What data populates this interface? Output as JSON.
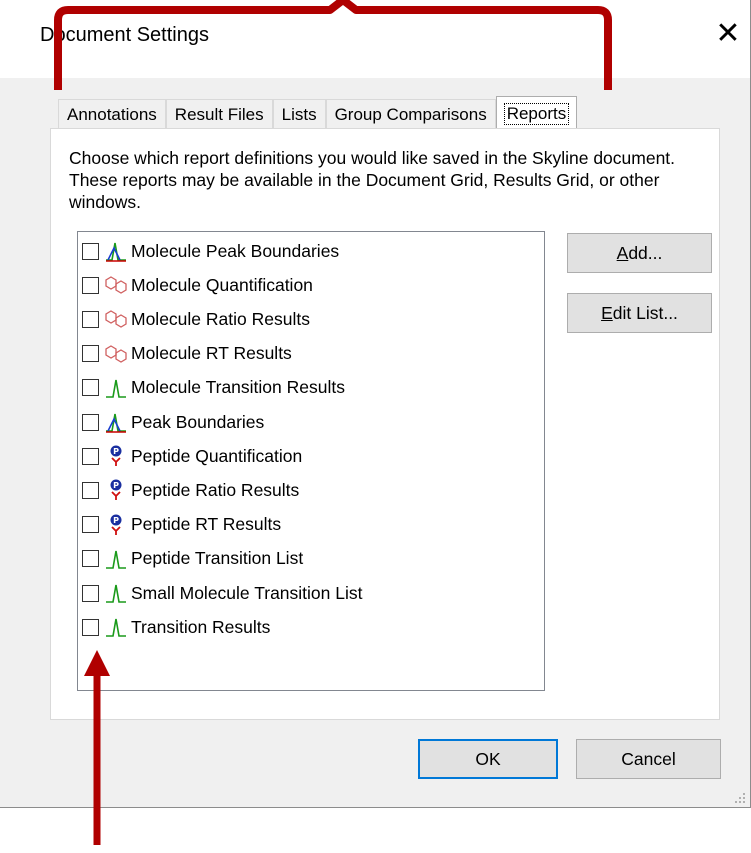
{
  "window": {
    "title": "Document Settings",
    "close_glyph": "✕"
  },
  "tabs": [
    {
      "label": "Annotations",
      "active": false
    },
    {
      "label": "Result Files",
      "active": false
    },
    {
      "label": "Lists",
      "active": false
    },
    {
      "label": "Group Comparisons",
      "active": false
    },
    {
      "label": "Reports",
      "active": true
    }
  ],
  "reports": {
    "description": "Choose which report definitions you would like saved in the Skyline document. These reports may be available in the Document Grid, Results Grid, or other windows.",
    "items": [
      {
        "label": "Molecule Peak Boundaries",
        "icon": "peak-boundaries-icon",
        "checked": false
      },
      {
        "label": "Molecule Quantification",
        "icon": "molecule-icon",
        "checked": false
      },
      {
        "label": "Molecule Ratio Results",
        "icon": "molecule-icon",
        "checked": false
      },
      {
        "label": "Molecule RT Results",
        "icon": "molecule-icon",
        "checked": false
      },
      {
        "label": "Molecule Transition Results",
        "icon": "transition-peak-icon",
        "checked": false
      },
      {
        "label": "Peak Boundaries",
        "icon": "peak-boundaries-icon",
        "checked": false
      },
      {
        "label": "Peptide Quantification",
        "icon": "peptide-icon",
        "checked": false
      },
      {
        "label": "Peptide Ratio Results",
        "icon": "peptide-icon",
        "checked": false
      },
      {
        "label": "Peptide RT Results",
        "icon": "peptide-icon",
        "checked": false
      },
      {
        "label": "Peptide Transition List",
        "icon": "transition-peak-icon",
        "checked": false
      },
      {
        "label": "Small Molecule Transition List",
        "icon": "transition-peak-icon",
        "checked": false
      },
      {
        "label": "Transition Results",
        "icon": "transition-peak-icon",
        "checked": false
      }
    ],
    "add_button": {
      "mnemonic": "A",
      "rest": "dd..."
    },
    "edit_button": {
      "mnemonic": "E",
      "rest": "dit List..."
    }
  },
  "footer": {
    "ok_label": "OK",
    "cancel_label": "Cancel"
  },
  "annotation_colors": {
    "callout": "#b00000",
    "focus": "#0078d7"
  }
}
